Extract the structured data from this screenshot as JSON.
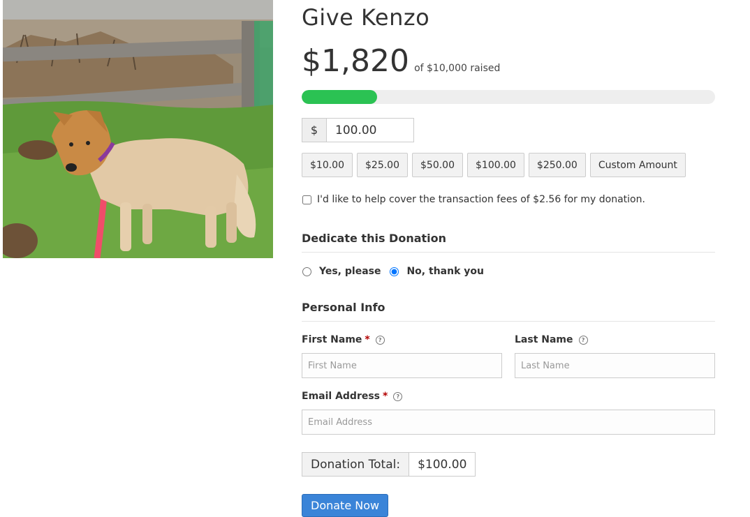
{
  "form": {
    "title": "Give Kenzo",
    "amount_raised": "$1,820",
    "goal_text": "of $10,000 raised",
    "progress_fraction": 0.182,
    "currency_symbol": "$",
    "amount_value": "100.00",
    "levels": [
      "$10.00",
      "$25.00",
      "$50.00",
      "$100.00",
      "$250.00",
      "Custom Amount"
    ],
    "fee_text": "I'd like to help cover the transaction fees of $2.56 for my donation.",
    "fee_checked": false
  },
  "dedicate": {
    "heading": "Dedicate this Donation",
    "options": [
      "Yes, please",
      "No, thank you"
    ],
    "selected": "No, thank you"
  },
  "personal": {
    "heading": "Personal Info",
    "first_name_label": "First Name",
    "first_name_placeholder": "First Name",
    "last_name_label": "Last Name",
    "last_name_placeholder": "Last Name",
    "email_label": "Email Address",
    "email_placeholder": "Email Address",
    "required_mark": "*",
    "help_glyph": "?"
  },
  "total": {
    "label": "Donation Total:",
    "value": "$100.00"
  },
  "submit": {
    "label": "Donate Now"
  },
  "colors": {
    "progress": "#2bc253",
    "button": "#3a84d8",
    "required": "#b30000"
  },
  "photo": {
    "icon": "dog-photo"
  }
}
